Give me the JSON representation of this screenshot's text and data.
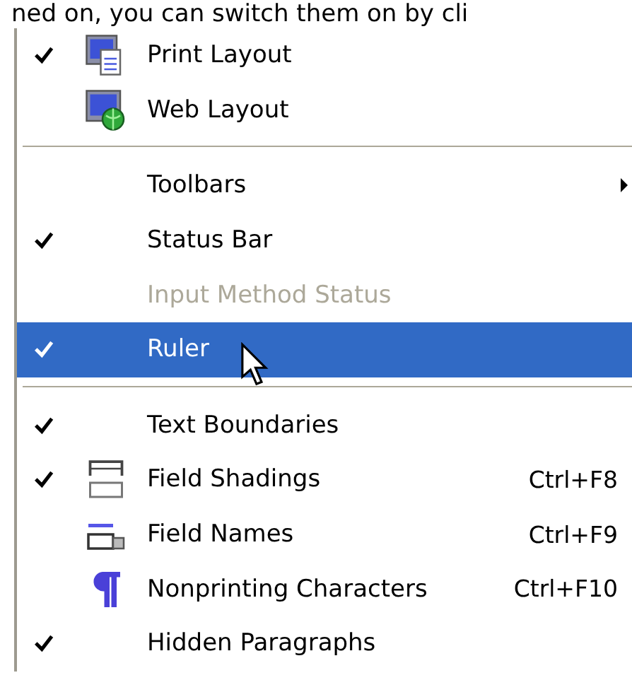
{
  "page_text": "ned on, you can switch them on by cli",
  "menu": {
    "items": [
      {
        "kind": "item",
        "label": "Print Layout",
        "checked": true,
        "disabled": false,
        "selected": false
      },
      {
        "kind": "item",
        "label": "Web Layout",
        "checked": false,
        "disabled": false,
        "selected": false
      },
      {
        "kind": "separator"
      },
      {
        "kind": "submenu",
        "label": "Toolbars",
        "checked": false,
        "disabled": false,
        "selected": false
      },
      {
        "kind": "item",
        "label": "Status Bar",
        "checked": true,
        "disabled": false,
        "selected": false
      },
      {
        "kind": "item",
        "label": "Input Method Status",
        "checked": false,
        "disabled": true,
        "selected": false
      },
      {
        "kind": "item",
        "label": "Ruler",
        "checked": true,
        "disabled": false,
        "selected": true
      },
      {
        "kind": "separator"
      },
      {
        "kind": "item",
        "label": "Text Boundaries",
        "checked": true,
        "disabled": false,
        "selected": false
      },
      {
        "kind": "item",
        "label": "Field Shadings",
        "checked": true,
        "disabled": false,
        "selected": false,
        "shortcut": "Ctrl+F8"
      },
      {
        "kind": "item",
        "label": "Field Names",
        "checked": false,
        "disabled": false,
        "selected": false,
        "shortcut": "Ctrl+F9"
      },
      {
        "kind": "item",
        "label": "Nonprinting Characters",
        "checked": false,
        "disabled": false,
        "selected": false,
        "shortcut": "Ctrl+F10"
      },
      {
        "kind": "item",
        "label": "Hidden Paragraphs",
        "checked": true,
        "disabled": false,
        "selected": false
      }
    ]
  }
}
